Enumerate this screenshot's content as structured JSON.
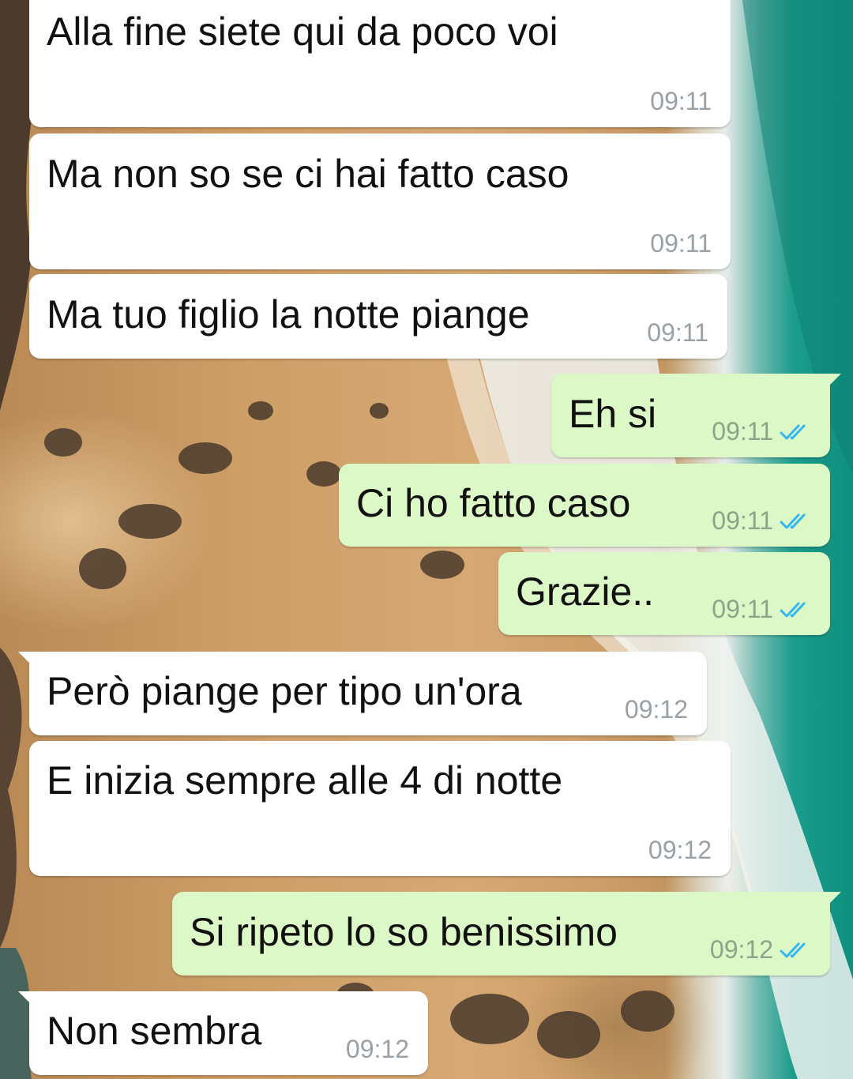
{
  "theme": {
    "incoming_bubble_color": "#ffffff",
    "outgoing_bubble_color": "#dcf8c6",
    "read_tick_color": "#34b7f1",
    "timestamp_color": "#9aa1a6"
  },
  "messages": [
    {
      "direction": "in",
      "text": "Alla fine siete qui da poco voi",
      "time": "09:11"
    },
    {
      "direction": "in",
      "text": "Ma non so se ci hai fatto caso",
      "time": "09:11"
    },
    {
      "direction": "in",
      "text": "Ma tuo figlio la notte piange",
      "time": "09:11"
    },
    {
      "direction": "out",
      "text": "Eh si",
      "time": "09:11",
      "status": "read",
      "status_icon": "double-check-icon"
    },
    {
      "direction": "out",
      "text": "Ci ho fatto caso",
      "time": "09:11",
      "status": "read",
      "status_icon": "double-check-icon"
    },
    {
      "direction": "out",
      "text": "Grazie..",
      "time": "09:11",
      "status": "read",
      "status_icon": "double-check-icon"
    },
    {
      "direction": "in",
      "text": "Però piange per tipo un'ora",
      "time": "09:12"
    },
    {
      "direction": "in",
      "text": "E inizia sempre alle 4 di notte",
      "time": "09:12"
    },
    {
      "direction": "out",
      "text": "Si ripeto lo so benissimo",
      "time": "09:12",
      "status": "read",
      "status_icon": "double-check-icon"
    },
    {
      "direction": "in",
      "text": "Non sembra",
      "time": "09:12"
    }
  ]
}
